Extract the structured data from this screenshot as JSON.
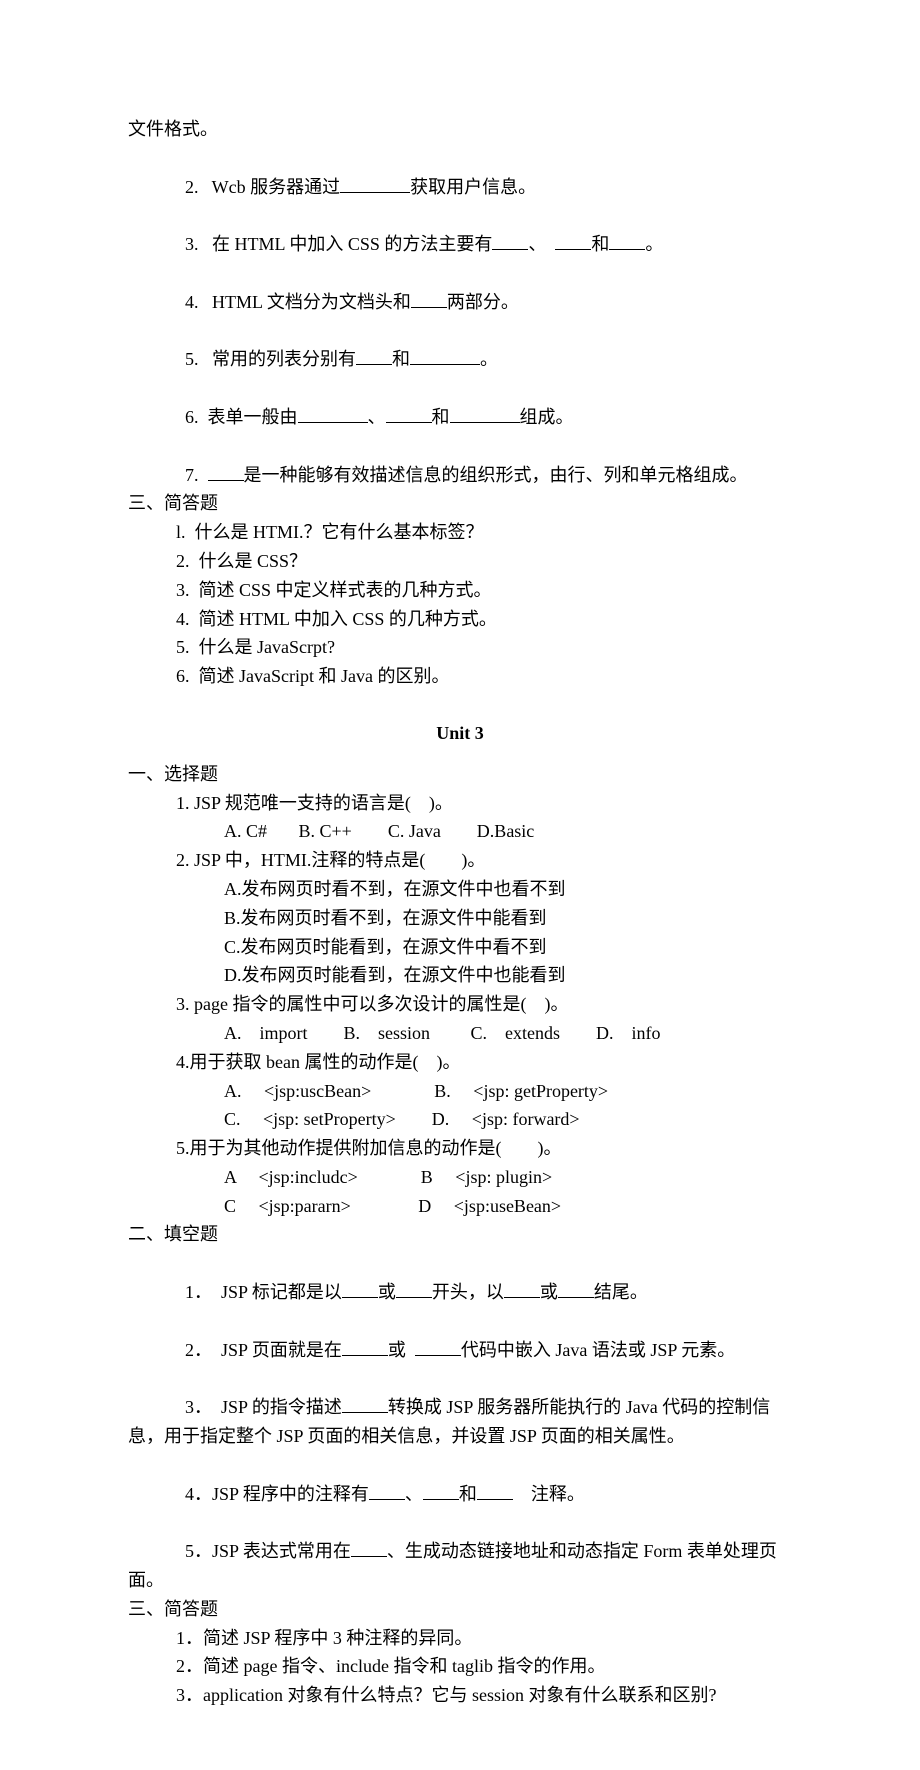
{
  "top": {
    "l1": "文件格式。",
    "l2a": "2.   Wcb 服务器通过",
    "l2b": "获取用户信息。",
    "l3a": "3.   在 HTML 中加入 CSS 的方法主要有",
    "l3b": "、",
    "l3c": "和",
    "l3d": "。",
    "l4a": "4.   HTML 文档分为文档头和",
    "l4b": "两部分。",
    "l5a": "5.   常用的列表分别有",
    "l5b": "和",
    "l5c": "。",
    "l6a": "6.  表单一般由",
    "l6b": "、",
    "l6c": "和",
    "l6d": "组成。",
    "l7a": "7.  ",
    "l7b": "是一种能够有效描述信息的组织形式，由行、列和单元格组成。"
  },
  "sec3": {
    "title": "三、简答题",
    "q1": "l.  什么是 HTMI.？它有什么基本标签？",
    "q2": "2.  什么是 CSS？",
    "q3": "3.  简述 CSS 中定义样式表的几种方式。",
    "q4": "4.  简述 HTML 中加入 CSS 的几种方式。",
    "q5": "5.  什么是 JavaScrpt?",
    "q6": "6.  简述 JavaScript 和 Java 的区别。"
  },
  "unit3": {
    "header": "Unit 3",
    "sec1": {
      "title": "一、选择题",
      "q1": "1. JSP 规范唯一支持的语言是(    )。",
      "q1opts": "A. C#       B. C++        C. Java        D.Basic",
      "q2": "2. JSP 中，HTMI.注释的特点是(        )。",
      "q2a": "A.发布网页时看不到，在源文件中也看不到",
      "q2b": "B.发布网页时看不到，在源文件中能看到",
      "q2c": "C.发布网页时能看到，在源文件中看不到",
      "q2d": "D.发布网页时能看到，在源文件中也能看到",
      "q3": "3. page 指令的属性中可以多次设计的属性是(    )。",
      "q3opts": "A.    import        B.    session         C.    extends        D.    info",
      "q4": "4.用于获取 bean 属性的动作是(    )。",
      "q4a": "A.     <jsp:uscBean>              B.     <jsp: getProperty>",
      "q4b": "C.     <jsp: setProperty>        D.     <jsp: forward>",
      "q5": "5.用于为其他动作提供附加信息的动作是(        )。",
      "q5a": "A     <jsp:includc>              B     <jsp: plugin>",
      "q5b": "C     <jsp:pararn>               D     <jsp:useBean>"
    },
    "sec2": {
      "title": "二、填空题",
      "l1a": "1．  JSP 标记都是以",
      "l1b": "或",
      "l1c": "开头，以",
      "l1d": "或",
      "l1e": "结尾。",
      "l2a": "2．  JSP 页面就是在",
      "l2b": "或  ",
      "l2c": "代码中嵌入 Java 语法或 JSP 元素。",
      "l3a": "3．  JSP 的指令描述",
      "l3b": "转换成 JSP 服务器所能执行的 Java 代码的控制信",
      "l3cont": "息，用于指定整个 JSP 页面的相关信息，并设置 JSP 页面的相关属性。",
      "l4a": "4．JSP 程序中的注释有",
      "l4b": "、",
      "l4c": "和",
      "l4d": "    注释。",
      "l5a": "5．JSP 表达式常用在",
      "l5b": "、生成动态链接地址和动态指定 Form 表单处理页",
      "l5cont": "面。"
    },
    "sec3": {
      "title": "三、简答题",
      "q1": "1．简述 JSP 程序中 3 种注释的异同。",
      "q2": "2．简述 page 指令、include 指令和 taglib 指令的作用。",
      "q3": "3．application 对象有什么特点？它与 session 对象有什么联系和区别?"
    }
  }
}
